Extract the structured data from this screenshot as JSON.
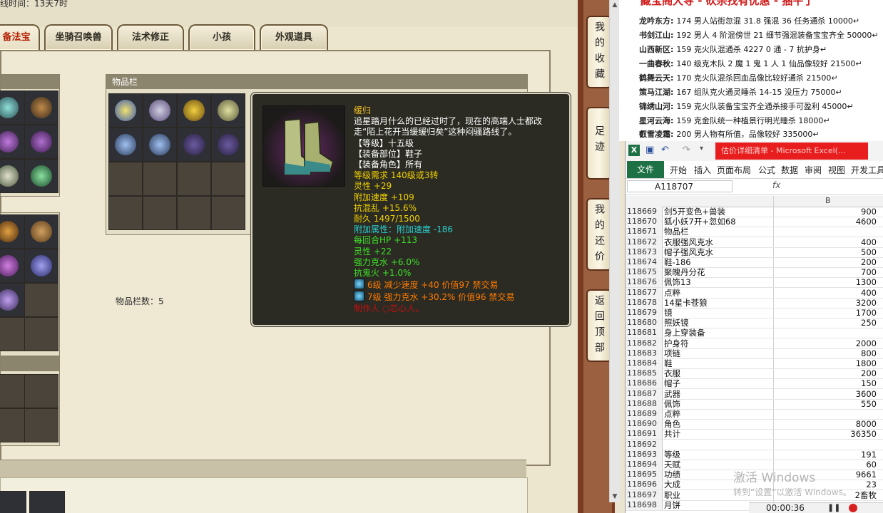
{
  "game": {
    "time_label": "线时间：13天7时",
    "tabs": [
      "备法宝",
      "坐骑召唤兽",
      "法术修正",
      "小孩",
      "外观道具"
    ],
    "inventory_title": "物品栏",
    "inventory_count": "物品栏数：5"
  },
  "tooltip": {
    "name": "缓归",
    "desc": [
      "追星踏月什么的已经过时了，现在的高端人士都改",
      "走“陌上花开当缓缓归矣”这种闷骚路线了。"
    ],
    "level": "【等级】十五级",
    "slot": "【装备部位】鞋子",
    "role": "【装备角色】所有",
    "req": "等级需求 140级或3转",
    "stats": [
      "灵性 +29",
      "附加速度 +109",
      "抗混乱 +15.6%",
      "耐久 1497/1500"
    ],
    "extra": "附加属性：附加速度 -186",
    "green": [
      "每回合HP +113",
      "灵性 +22",
      "强力克水 +6.0%",
      "抗鬼火 +1.0%"
    ],
    "gems": [
      "6级 减少速度 +40 价值97 禁交易",
      "7级 强力克水 +30.2% 价值96 禁交易"
    ],
    "maker": "制作人 ○芯心人。"
  },
  "nav": {
    "buttons": [
      "我的收藏",
      "足迹",
      "我的还价",
      "返回顶部"
    ]
  },
  "news": {
    "title": "藏宝阁大导 - 砍杀找有优惠 - 捆平了",
    "rows": [
      {
        "server": "龙吟东方:",
        "text": "174 男人站街忽混 31.8 强混 36 任务通杀 10000↵"
      },
      {
        "server": "书剑江山:",
        "text": "192 男人 4 阶混傍世 21 细节强混装备宝宝齐全 50000↵"
      },
      {
        "server": "山西新区:",
        "text": "159 克火队混通杀 4227 0 通 - 7 抗护身↵"
      },
      {
        "server": "一曲春秋:",
        "text": "140 级克木队 2 魔 1 鬼 1 人 1 仙品像较好 21500↵"
      },
      {
        "server": "鹤舞云天:",
        "text": "170 克火队混杀回血品像比较好通杀 21500↵"
      },
      {
        "server": "策马江湖:",
        "text": "167 组队克火通灵睡杀 14-15 没压力 75000↵"
      },
      {
        "server": "锦绣山河:",
        "text": "159 克火队装备宝宝齐全通杀接手可盈利 45000↵"
      },
      {
        "server": "星河云海:",
        "text": "159 克金队统一种植景行明光睡杀 18000↵"
      },
      {
        "server": "叡雪凌霜:",
        "text": "200 男人物有所值，品像较好 335000↵"
      }
    ]
  },
  "excel": {
    "title": "估价详细清单 - Microsoft Excel(...",
    "ribbon_tabs": [
      "文件",
      "开始",
      "插入",
      "页面布局",
      "公式",
      "数据",
      "审阅",
      "视图",
      "开发工具"
    ],
    "name_box": "A118707",
    "fx": "fx",
    "col_b": "B",
    "rows": [
      {
        "n": "118669",
        "a": "剑5开变色+兽装",
        "b": "900"
      },
      {
        "n": "118670",
        "a": "狐小妖7开+忽如68",
        "b": "4600"
      },
      {
        "n": "118671",
        "a": "物品栏",
        "b": ""
      },
      {
        "n": "118672",
        "a": "衣服强风克水",
        "b": "400"
      },
      {
        "n": "118673",
        "a": "帽子强风克水",
        "b": "500"
      },
      {
        "n": "118674",
        "a": "鞋-186",
        "b": "200"
      },
      {
        "n": "118675",
        "a": "聚魄丹分花",
        "b": "700"
      },
      {
        "n": "118676",
        "a": "佩饰13",
        "b": "1300"
      },
      {
        "n": "118677",
        "a": "点粹",
        "b": "400"
      },
      {
        "n": "118678",
        "a": "14星卡苍狼",
        "b": "3200"
      },
      {
        "n": "118679",
        "a": "镜",
        "b": "1700"
      },
      {
        "n": "118680",
        "a": "照妖镜",
        "b": "250"
      },
      {
        "n": "118681",
        "a": "身上穿装备",
        "b": ""
      },
      {
        "n": "118682",
        "a": "护身符",
        "b": "2000"
      },
      {
        "n": "118683",
        "a": "项链",
        "b": "800"
      },
      {
        "n": "118684",
        "a": "鞋",
        "b": "1800"
      },
      {
        "n": "118685",
        "a": "衣服",
        "b": "200"
      },
      {
        "n": "118686",
        "a": "帽子",
        "b": "150"
      },
      {
        "n": "118687",
        "a": "武器",
        "b": "3600"
      },
      {
        "n": "118688",
        "a": "佩饰",
        "b": "550"
      },
      {
        "n": "118689",
        "a": "点粹",
        "b": ""
      },
      {
        "n": "118690",
        "a": "角色",
        "b": "8000"
      },
      {
        "n": "118691",
        "a": "共计",
        "b": "36350"
      },
      {
        "n": "118692",
        "a": "",
        "b": ""
      },
      {
        "n": "118693",
        "a": "等级",
        "b": "191"
      },
      {
        "n": "118694",
        "a": "天赋",
        "b": "60"
      },
      {
        "n": "118695",
        "a": "功绩",
        "b": "9661"
      },
      {
        "n": "118696",
        "a": "大成",
        "b": "23"
      },
      {
        "n": "118697",
        "a": "职业",
        "b": "2畜牧"
      },
      {
        "n": "118698",
        "a": "月饼",
        "b": ""
      }
    ]
  },
  "watermark": {
    "line1": "激活 Windows",
    "line2": "转到“设置”以激活 Windows。"
  },
  "recorder": {
    "time": "00:00:36"
  }
}
